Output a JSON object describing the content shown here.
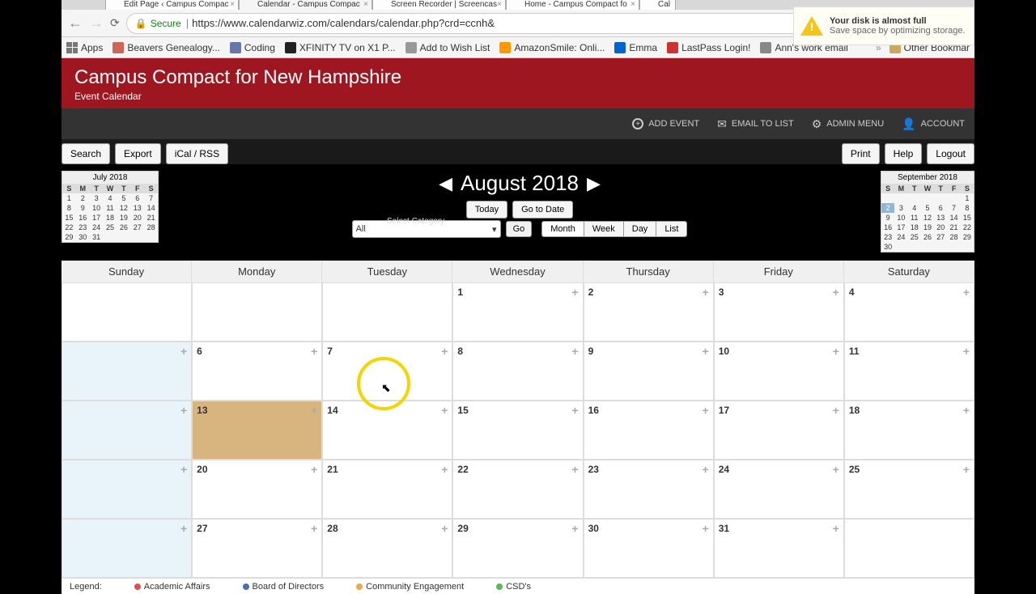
{
  "browser": {
    "tabs": [
      {
        "label": "Edit Page ‹ Campus Compac"
      },
      {
        "label": "Calendar - Campus Compac"
      },
      {
        "label": "Screen Recorder | Screencas"
      },
      {
        "label": "Home - Campus Compact fo"
      },
      {
        "label": "Cal"
      }
    ],
    "secure": "Secure",
    "url": "https://www.calendarwiz.com/calendars/calendar.php?crd=ccnh&"
  },
  "bookmarks": {
    "apps": "Apps",
    "items": [
      "Beavers Genealogy...",
      "Coding",
      "XFINITY TV on X1 P...",
      "Add to Wish List",
      "AmazonSmile: Onli...",
      "Emma",
      "LastPass Login!",
      "Ann's work email"
    ],
    "other": "Other Bookmar"
  },
  "notification": {
    "title": "Your disk is almost full",
    "subtitle": "Save space by optimizing storage."
  },
  "header": {
    "title": "Campus Compact for New Hampshire",
    "subtitle": "Event Calendar"
  },
  "actions": {
    "add_event": "ADD EVENT",
    "email_list": "EMAIL TO LIST",
    "admin_menu": "ADMIN MENU",
    "account": "ACCOUNT"
  },
  "toolbar": {
    "search": "Search",
    "export": "Export",
    "ical": "iCal / RSS",
    "print": "Print",
    "help": "Help",
    "logout": "Logout"
  },
  "mini_prev": {
    "title": "July 2018",
    "heads": [
      "S",
      "M",
      "T",
      "W",
      "T",
      "F",
      "S"
    ],
    "rows": [
      [
        "1",
        "2",
        "3",
        "4",
        "5",
        "6",
        "7"
      ],
      [
        "8",
        "9",
        "10",
        "11",
        "12",
        "13",
        "14"
      ],
      [
        "15",
        "16",
        "17",
        "18",
        "19",
        "20",
        "21"
      ],
      [
        "22",
        "23",
        "24",
        "25",
        "26",
        "27",
        "28"
      ],
      [
        "29",
        "30",
        "31",
        "",
        "",
        "",
        ""
      ]
    ]
  },
  "mini_next": {
    "title": "September 2018",
    "heads": [
      "S",
      "M",
      "T",
      "W",
      "T",
      "F",
      "S"
    ],
    "rows": [
      [
        "",
        "",
        "",
        "",
        "",
        "",
        "1"
      ],
      [
        "2",
        "3",
        "4",
        "5",
        "6",
        "7",
        "8"
      ],
      [
        "9",
        "10",
        "11",
        "12",
        "13",
        "14",
        "15"
      ],
      [
        "16",
        "17",
        "18",
        "19",
        "20",
        "21",
        "22"
      ],
      [
        "23",
        "24",
        "25",
        "26",
        "27",
        "28",
        "29"
      ],
      [
        "30",
        "",
        "",
        "",
        "",
        "",
        ""
      ]
    ],
    "hi": [
      "2"
    ]
  },
  "nav": {
    "month": "August 2018",
    "today": "Today",
    "goto_date": "Go to Date"
  },
  "category": {
    "label": "Select Category",
    "selected": "All",
    "go": "Go"
  },
  "views": {
    "month": "Month",
    "week": "Week",
    "day": "Day",
    "list": "List"
  },
  "day_headers": [
    "Sunday",
    "Monday",
    "Tuesday",
    "Wednesday",
    "Thursday",
    "Friday",
    "Saturday"
  ],
  "weeks": [
    [
      "",
      "",
      "",
      "1",
      "2",
      "3",
      "4"
    ],
    [
      "",
      "6",
      "7",
      "8",
      "9",
      "10",
      "11"
    ],
    [
      "",
      "13",
      "14",
      "15",
      "16",
      "17",
      "18"
    ],
    [
      "",
      "20",
      "21",
      "22",
      "23",
      "24",
      "25"
    ],
    [
      "",
      "27",
      "28",
      "29",
      "30",
      "31",
      ""
    ]
  ],
  "legend": {
    "title": "Legend:",
    "items": [
      {
        "label": "Academic Affairs",
        "color": "#d9534f"
      },
      {
        "label": "Board of Directors",
        "color": "#4a6db5"
      },
      {
        "label": "Community Engagement",
        "color": "#e8a94f"
      },
      {
        "label": "CSD's",
        "color": "#5cb85c"
      }
    ]
  }
}
